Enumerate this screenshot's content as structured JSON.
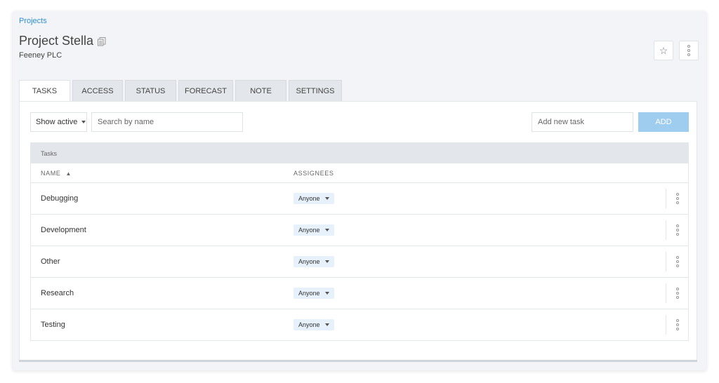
{
  "breadcrumb": "Projects",
  "header": {
    "title": "Project Stella",
    "client": "Feeney PLC",
    "star_label": "☆"
  },
  "tabs": [
    {
      "label": "TASKS",
      "active": true
    },
    {
      "label": "ACCESS",
      "active": false
    },
    {
      "label": "STATUS",
      "active": false
    },
    {
      "label": "FORECAST",
      "active": false
    },
    {
      "label": "NOTE",
      "active": false
    },
    {
      "label": "SETTINGS",
      "active": false
    }
  ],
  "toolbar": {
    "filter_value": "Show active",
    "search_placeholder": "Search by name",
    "new_task_placeholder": "Add new task",
    "add_label": "ADD"
  },
  "table": {
    "caption": "Tasks",
    "columns": {
      "name": "NAME",
      "assignees": "ASSIGNEES"
    },
    "rows": [
      {
        "name": "Debugging",
        "assignee": "Anyone"
      },
      {
        "name": "Development",
        "assignee": "Anyone"
      },
      {
        "name": "Other",
        "assignee": "Anyone"
      },
      {
        "name": "Research",
        "assignee": "Anyone"
      },
      {
        "name": "Testing",
        "assignee": "Anyone"
      }
    ]
  },
  "colors": {
    "accent": "#2d8ed6",
    "add_button": "#9fcdf0",
    "chip": "#e6f1fb"
  },
  "icons": {
    "copy": "copy-icon",
    "star": "star-icon",
    "more": "more-vertical-icon",
    "sort": "sort-ascending-icon"
  }
}
